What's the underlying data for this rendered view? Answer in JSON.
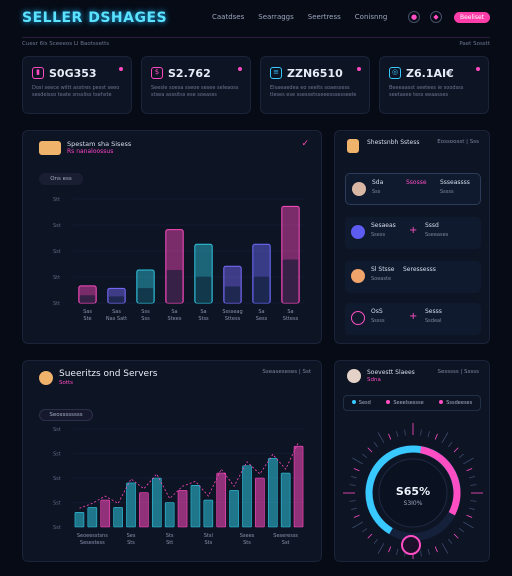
{
  "header": {
    "brand": "SELLER DSHAGES",
    "nav": [
      "Caatdses",
      "Searraggs",
      "Seertress",
      "Conisnng"
    ],
    "cta_label": "Beeliset",
    "icons": [
      "bell-icon",
      "user-icon"
    ]
  },
  "breadcrumb": {
    "left": "Cuesr 6ls Sceeeos Ll Baotssetts",
    "right": "Paet Sosstt"
  },
  "kpis": [
    {
      "value": "S0G353",
      "note": "Dosi seece wiltt asstres pesst seeo sesdeisso teate snssliss tsehste",
      "icon": "chart-icon",
      "color": "#ff49c0"
    },
    {
      "value": "S2.762",
      "note": "Seesle soesa sseoe sesee seleaoss stsea asssitss ese soeasss",
      "icon": "dollar-icon",
      "color": "#ff49c0"
    },
    {
      "value": "ZZN6510",
      "note": "Elsaeaedea eo seelts soaessess tleses ese ssessetsseeesssesseele",
      "icon": "server-icon",
      "color": "#37c9ff"
    },
    {
      "value": "Z6.1AI€",
      "note": "Beeeaasst seetees ie soodsss seetasee tess eeaasses",
      "icon": "globe-icon",
      "color": "#37c9ff"
    }
  ],
  "bar_panel": {
    "title": "Spestam sha Sisess",
    "subtitle": "Rs nanaloossus",
    "pill": "Ons ess",
    "chart_data": {
      "type": "bar",
      "categories": [
        "Ste",
        "Nas Satt",
        "Sss",
        "Stees",
        "Stss",
        "Sttess",
        "Sess",
        "Sttess"
      ],
      "sublabels": [
        "Sas",
        "Sas",
        "Sss",
        "Sa",
        "Sa",
        "Sssseag",
        "Sa",
        "Sa"
      ],
      "values": [
        28,
        24,
        54,
        120,
        96,
        60,
        96,
        158
      ],
      "ylim": [
        0,
        170
      ],
      "yticks": [
        "Stt",
        "Stt",
        "Sst",
        "Sst",
        "Stt"
      ],
      "colors": [
        "#ff49c0",
        "#7a6cff",
        "#2fc5df",
        "#ff49c0",
        "#2fc5df",
        "#7a6cff",
        "#6d6cff",
        "#ff49c0"
      ]
    }
  },
  "side_panel": {
    "title": "Shestsnbh Sstess",
    "meta": "Eossoosst | Sss",
    "rows": [
      {
        "name": "Sda",
        "sub": "Sss",
        "pink": "Ssosse",
        "name2": "Ssseassss",
        "sub2": "Sssss",
        "avatar": "#d9b7a5"
      },
      {
        "name": "Sesaeas",
        "sub": "Ssess",
        "pink": "+",
        "name2": "Sssd",
        "sub2": "Sseeases",
        "avatar": "#5d5cf2"
      },
      {
        "name": "Sl Stsse",
        "sub": "Soeaste",
        "pink": "",
        "name2": "Seressesss",
        "sub2": "",
        "avatar": "#f0a36b"
      },
      {
        "name": "OsS",
        "sub": "Sssss",
        "pink": "+",
        "name2": "Sesss",
        "sub2": "Ssdeal",
        "avatar": "#ff4ec4"
      }
    ]
  },
  "bottom_panel": {
    "title": "Sueeritzs ond Servers",
    "subtitle": "Sotts",
    "meta": "Sseaseseses | Sst",
    "pill": "Seossssssss",
    "chart_data": {
      "type": "bar",
      "categories": [
        "Seoeesstsns",
        "Ses",
        "Sts",
        "Stsl",
        "Ssees",
        "Seseresss"
      ],
      "sublabels": [
        "Sesestess",
        "Sts",
        "Stt",
        "Sts",
        "Sts",
        "Sst"
      ],
      "values": [
        12,
        16,
        22,
        16,
        36,
        28,
        40,
        20,
        30,
        34,
        22,
        44,
        30,
        50,
        40,
        56,
        44,
        66
      ],
      "ylim": [
        0,
        80
      ],
      "yticks": [
        "Sst",
        "Sst",
        "Sst",
        "Sst",
        "Sst"
      ],
      "colors": [
        "#2fc5df",
        "#ff49c0"
      ]
    }
  },
  "gauge_panel": {
    "title": "Soevestt Slaees",
    "subtitle": "Sdna",
    "meta": "Sesssss | Sssss",
    "legend": [
      {
        "label": "Sesd",
        "color": "#37c9ff"
      },
      {
        "label": "Seeelsessse",
        "color": "#ff4ec4"
      },
      {
        "label": "Sssdeeses",
        "color": "#ff4ec4"
      }
    ],
    "percent": "S65%",
    "percent_value": 0.65,
    "caption": "S3I0%"
  }
}
